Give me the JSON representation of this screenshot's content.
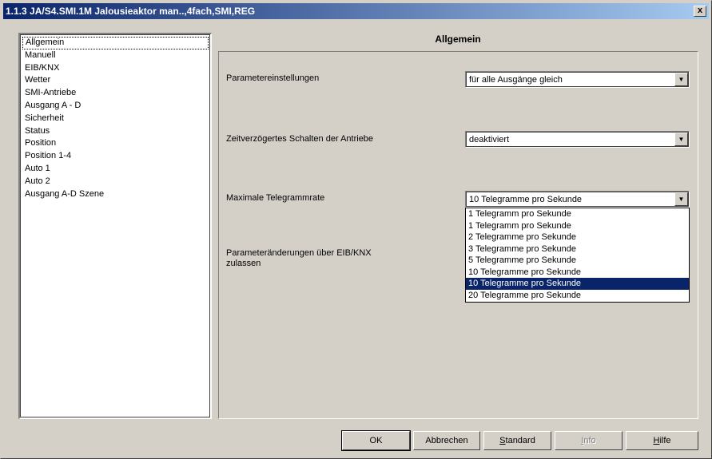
{
  "window": {
    "title": "1.1.3 JA/S4.SMI.1M Jalousieaktor man..,4fach,SMI,REG",
    "close_glyph": "x"
  },
  "nav": {
    "items": [
      {
        "label": "Allgemein",
        "selected": true
      },
      {
        "label": "Manuell"
      },
      {
        "label": "EIB/KNX"
      },
      {
        "label": "Wetter"
      },
      {
        "label": "SMI-Antriebe"
      },
      {
        "label": "Ausgang A - D"
      },
      {
        "label": "Sicherheit"
      },
      {
        "label": "Status"
      },
      {
        "label": "Position"
      },
      {
        "label": "Position 1-4"
      },
      {
        "label": "Auto 1"
      },
      {
        "label": "Auto 2"
      },
      {
        "label": "Ausgang A-D Szene"
      }
    ]
  },
  "section": {
    "title": "Allgemein"
  },
  "params": [
    {
      "label": "Parametereinstellungen",
      "value": "für alle Ausgänge gleich"
    },
    {
      "label": "Zeitverzögertes Schalten der Antriebe",
      "value": "deaktiviert"
    },
    {
      "label": "Maximale Telegrammrate",
      "value": "10 Telegramme pro Sekunde"
    },
    {
      "label_line1": "Parameteränderungen über EIB/KNX",
      "label_line2": "zulassen"
    }
  ],
  "dropdown": {
    "options": [
      "1 Telegramm pro Sekunde",
      "1 Telegramm pro Sekunde",
      "2 Telegramme pro Sekunde",
      "3 Telegramme pro Sekunde",
      "5 Telegramme pro Sekunde",
      "10 Telegramme pro Sekunde",
      "10 Telegramme pro Sekunde",
      "20 Telegramme pro Sekunde"
    ],
    "highlighted_index": 6
  },
  "buttons": {
    "ok": "OK",
    "cancel": "Abbrechen",
    "standard_first": "S",
    "standard_rest": "tandard",
    "info_first": "I",
    "info_rest": "nfo",
    "help_first": "H",
    "help_rest": "ilfe"
  },
  "colors": {
    "titlebar_start": "#0a246a",
    "titlebar_end": "#a6caf0",
    "highlight": "#0a246a",
    "face": "#d4d0c8"
  },
  "icons": {
    "combo_arrow": "▼"
  }
}
